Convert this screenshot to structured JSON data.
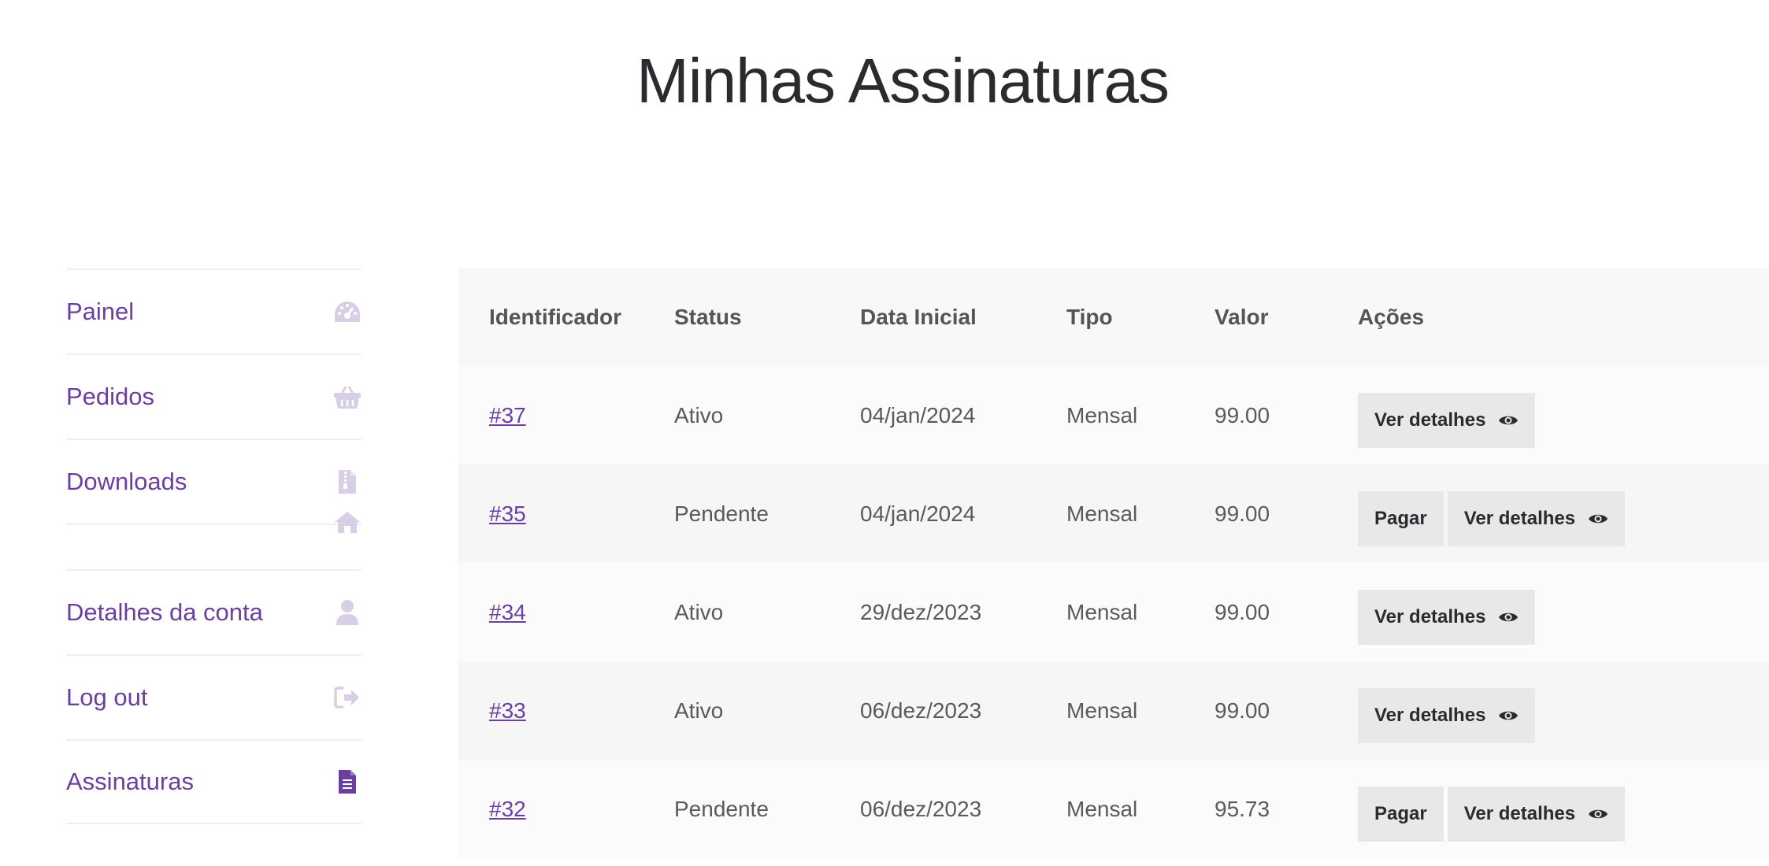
{
  "page": {
    "title": "Minhas Assinaturas"
  },
  "sidebar": {
    "items": [
      {
        "label": "Painel",
        "icon": "dashboard-icon"
      },
      {
        "label": "Pedidos",
        "icon": "basket-icon"
      },
      {
        "label": "Downloads",
        "icon": "file-archive-icon"
      },
      {
        "label": "",
        "icon": "home-icon"
      },
      {
        "label": "Detalhes da conta",
        "icon": "user-icon"
      },
      {
        "label": "Log out",
        "icon": "sign-out-icon"
      },
      {
        "label": "Assinaturas",
        "icon": "file-text-icon",
        "active": true
      }
    ]
  },
  "table": {
    "headers": [
      "Identificador",
      "Status",
      "Data Inicial",
      "Tipo",
      "Valor",
      "Ações"
    ],
    "rows": [
      {
        "id": "#37",
        "status": "Ativo",
        "date": "04/jan/2024",
        "type": "Mensal",
        "value": "99.00",
        "pay": null,
        "details": "Ver detalhes"
      },
      {
        "id": "#35",
        "status": "Pendente",
        "date": "04/jan/2024",
        "type": "Mensal",
        "value": "99.00",
        "pay": "Pagar",
        "details": "Ver detalhes"
      },
      {
        "id": "#34",
        "status": "Ativo",
        "date": "29/dez/2023",
        "type": "Mensal",
        "value": "99.00",
        "pay": null,
        "details": "Ver detalhes"
      },
      {
        "id": "#33",
        "status": "Ativo",
        "date": "06/dez/2023",
        "type": "Mensal",
        "value": "99.00",
        "pay": null,
        "details": "Ver detalhes"
      },
      {
        "id": "#32",
        "status": "Pendente",
        "date": "06/dez/2023",
        "type": "Mensal",
        "value": "95.73",
        "pay": "Pagar",
        "details": "Ver detalhes"
      }
    ]
  },
  "colors": {
    "accent": "#6b3fa0",
    "icon_muted": "#d8cfe6",
    "header_bg": "#f8f8f8",
    "button_bg": "#e8e8e8"
  }
}
